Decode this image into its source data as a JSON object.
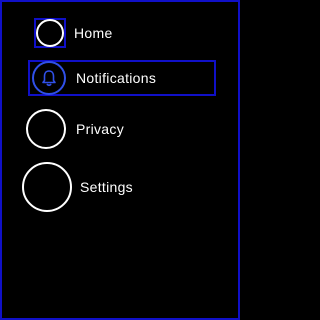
{
  "menu": {
    "items": [
      {
        "label": "Home",
        "icon": "circle-icon",
        "focused": false
      },
      {
        "label": "Notifications",
        "icon": "bell-icon",
        "focused": true
      },
      {
        "label": "Privacy",
        "icon": "circle-icon",
        "focused": false
      },
      {
        "label": "Settings",
        "icon": "circle-icon",
        "focused": false
      }
    ]
  },
  "colors": {
    "background": "#000000",
    "focus_border": "#1010c8",
    "accent": "#3050e8",
    "text": "#ffffff"
  }
}
